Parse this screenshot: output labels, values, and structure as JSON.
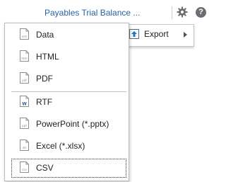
{
  "header": {
    "report_title": "Payables Trial Balance ..."
  },
  "menu": {
    "export_label": "Export"
  },
  "export_submenu": {
    "items": [
      {
        "label": "Data",
        "badge": "xml"
      },
      {
        "label": "HTML",
        "badge": "htm"
      },
      {
        "label": "PDF",
        "badge": "pdf"
      },
      {
        "label": "RTF",
        "badge": "W"
      },
      {
        "label": "PowerPoint (*.pptx)",
        "badge": "ppt"
      },
      {
        "label": "Excel (*.xlsx)",
        "badge": "xls"
      },
      {
        "label": "CSV",
        "badge": "csv"
      }
    ],
    "selected_index": 6
  },
  "colors": {
    "title_link": "#2b5fa8",
    "divider": "#b9c3cf"
  }
}
